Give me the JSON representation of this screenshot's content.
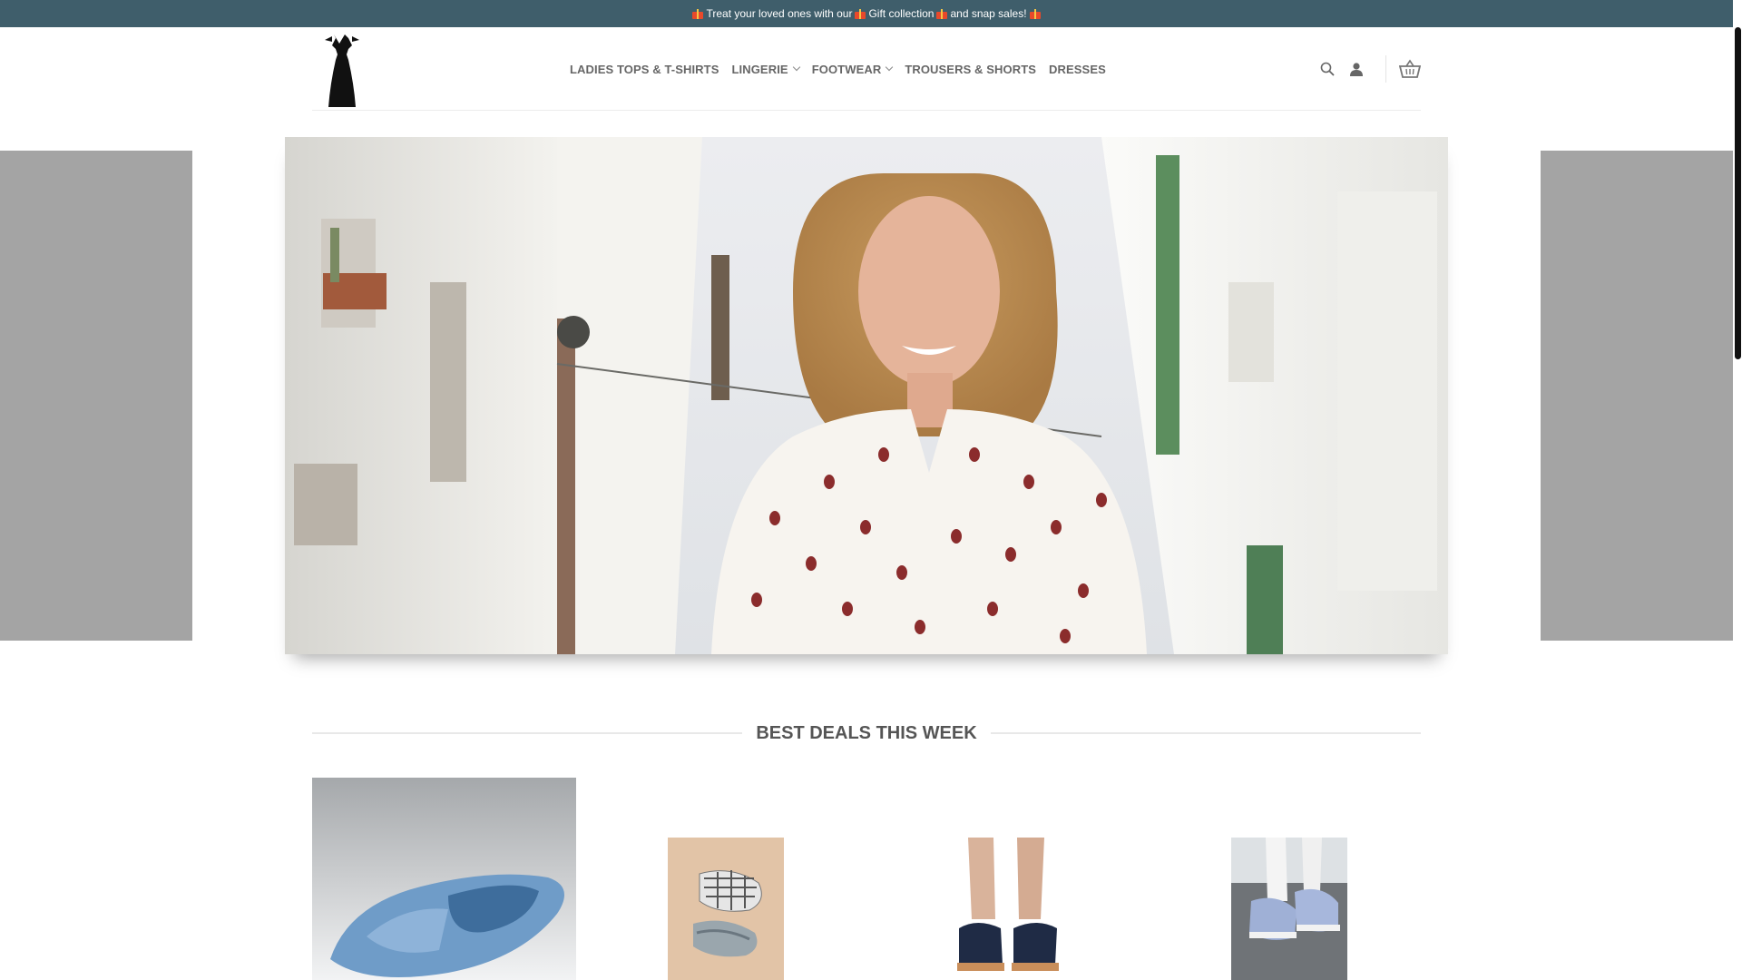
{
  "announcement": {
    "part1": "Treat your loved ones with our ",
    "part2": "Gift collection",
    "part3": " and snap sales!"
  },
  "header": {
    "logo_name": "dress-silhouette-logo",
    "nav": [
      {
        "label": "LADIES TOPS & T-SHIRTS",
        "has_dropdown": false
      },
      {
        "label": "LINGERIE",
        "has_dropdown": true
      },
      {
        "label": "FOOTWEAR",
        "has_dropdown": true
      },
      {
        "label": "TROUSERS & SHORTS",
        "has_dropdown": false
      },
      {
        "label": "DRESSES",
        "has_dropdown": false
      }
    ],
    "icons": [
      "search-icon",
      "user-icon",
      "basket-icon"
    ]
  },
  "hero": {
    "image": "woman-in-white-patterned-blouse-street"
  },
  "section": {
    "title": "BEST DEALS THIS WEEK"
  },
  "products": [
    {
      "image": "blue-open-toe-slipper"
    },
    {
      "image": "checked-slippers"
    },
    {
      "image": "navy-sandals-on-feet"
    },
    {
      "image": "blue-lace-up-trainers"
    }
  ],
  "colors": {
    "topbar": "#3f5e6b",
    "nav_text": "#666666",
    "title_text": "#555555"
  }
}
